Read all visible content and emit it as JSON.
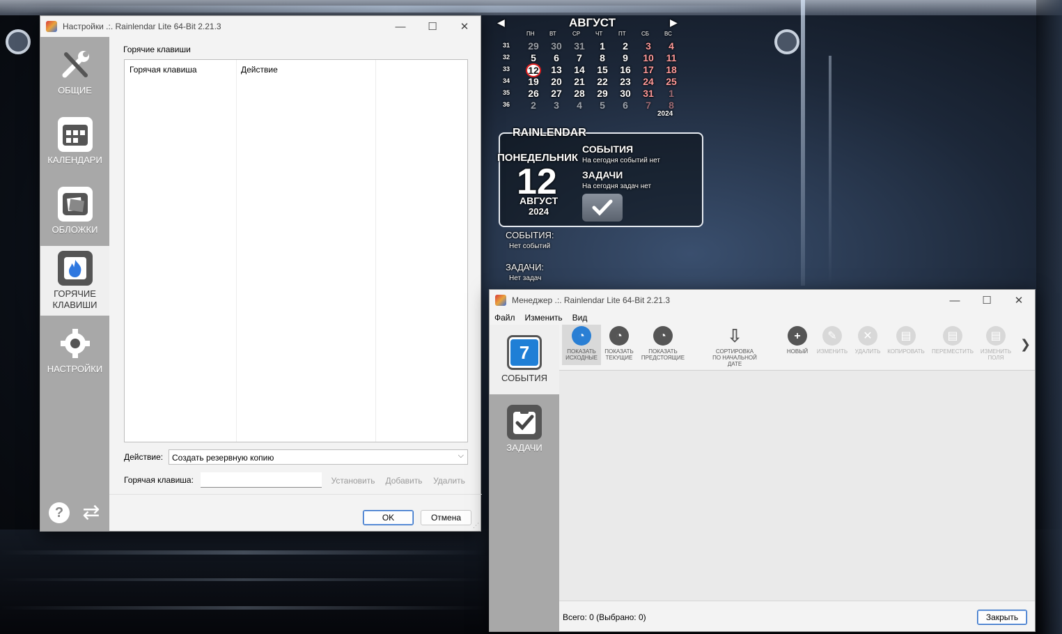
{
  "settings_window": {
    "title": "Настройки .:. Rainlendar Lite 64-Bit 2.21.3",
    "sidebar": [
      {
        "label": "ОБЩИЕ",
        "icon": "tools-icon"
      },
      {
        "label": "КАЛЕНДАРИ",
        "icon": "calendar-grid-icon"
      },
      {
        "label": "ОБЛОЖКИ",
        "icon": "skins-icon"
      },
      {
        "label": "ГОРЯЧИЕ\nКЛАВИШИ",
        "icon": "flame-icon"
      },
      {
        "label": "НАСТРОЙКИ",
        "icon": "gear-icon"
      }
    ],
    "group_title": "Горячие клавиши",
    "table_headers": [
      "Горячая клавиша",
      "Действие"
    ],
    "action_label": "Действие:",
    "action_value": "Создать резервную копию",
    "hotkey_label": "Горячая клавиша:",
    "hotkey_value": "",
    "set_button": "Установить",
    "add_button": "Добавить",
    "delete_button": "Удалить",
    "ok_button": "OK",
    "cancel_button": "Отмена"
  },
  "calendar": {
    "month": "АВГУСТ",
    "year_small": "2024",
    "weekdays": [
      "ПН",
      "ВТ",
      "СР",
      "ЧТ",
      "ПТ",
      "СБ",
      "ВС"
    ],
    "weeks": [
      {
        "num": "31",
        "days": [
          "29",
          "30",
          "31",
          "1",
          "2",
          "3",
          "4"
        ]
      },
      {
        "num": "32",
        "days": [
          "5",
          "6",
          "7",
          "8",
          "9",
          "10",
          "11"
        ]
      },
      {
        "num": "33",
        "days": [
          "12",
          "13",
          "14",
          "15",
          "16",
          "17",
          "18"
        ]
      },
      {
        "num": "34",
        "days": [
          "19",
          "20",
          "21",
          "22",
          "23",
          "24",
          "25"
        ]
      },
      {
        "num": "35",
        "days": [
          "26",
          "27",
          "28",
          "29",
          "30",
          "31",
          "1"
        ]
      },
      {
        "num": "36",
        "days": [
          "2",
          "3",
          "4",
          "5",
          "6",
          "7",
          "8"
        ]
      }
    ],
    "weekend_color": "#ff9a9a",
    "today_ring_color": "#e02020"
  },
  "today_widget": {
    "brand": "RAINLENDAR",
    "weekday": "ПОНЕДЕЛЬНИК",
    "day": "12",
    "month": "АВГУСТ",
    "year": "2024",
    "events_title": "СОБЫТИЯ",
    "events_text": "На сегодня событий нет",
    "tasks_title": "ЗАДАЧИ",
    "tasks_text": "На сегодня задач нет"
  },
  "list_widget": {
    "events_title": "СОБЫТИЯ:",
    "events_text": "Нет событий",
    "tasks_title": "ЗАДАЧИ:",
    "tasks_text": "Нет задач"
  },
  "manager_window": {
    "title": "Менеджер .:. Rainlendar Lite 64-Bit 2.21.3",
    "menu": [
      "Файл",
      "Изменить",
      "Вид"
    ],
    "sidebar": [
      {
        "label": "СОБЫТИЯ",
        "icon": "calendar-7-icon",
        "badge": "7"
      },
      {
        "label": "ЗАДАЧИ",
        "icon": "clipboard-check-icon"
      }
    ],
    "toolbar": [
      {
        "label": "ПОКАЗАТЬ\nИСХОДНЫЕ",
        "icon": "show-source-icon",
        "enabled": true
      },
      {
        "label": "ПОКАЗАТЬ\nТЕКУЩИЕ",
        "icon": "show-current-icon",
        "enabled": true
      },
      {
        "label": "ПОКАЗАТЬ\nПРЕДСТОЯЩИЕ",
        "icon": "show-upcoming-icon",
        "enabled": true
      },
      {
        "label": "СОРТИРОВКА\nПО НАЧАЛЬНОЙ ДАТЕ",
        "icon": "sort-icon",
        "enabled": true
      },
      {
        "label": "НОВЫЙ",
        "icon": "plus-icon",
        "enabled": true
      },
      {
        "label": "ИЗМЕНИТЬ",
        "icon": "edit-icon",
        "enabled": false
      },
      {
        "label": "УДАЛИТЬ",
        "icon": "delete-icon",
        "enabled": false
      },
      {
        "label": "КОПИРОВАТЬ",
        "icon": "copy-icon",
        "enabled": false
      },
      {
        "label": "ПЕРЕМЕСТИТЬ",
        "icon": "move-icon",
        "enabled": false
      },
      {
        "label": "ИЗМЕНИТЬ\nПОЛЯ",
        "icon": "fields-icon",
        "enabled": false
      }
    ],
    "status": "Всего: 0 (Выбрано: 0)",
    "close_button": "Закрыть"
  }
}
